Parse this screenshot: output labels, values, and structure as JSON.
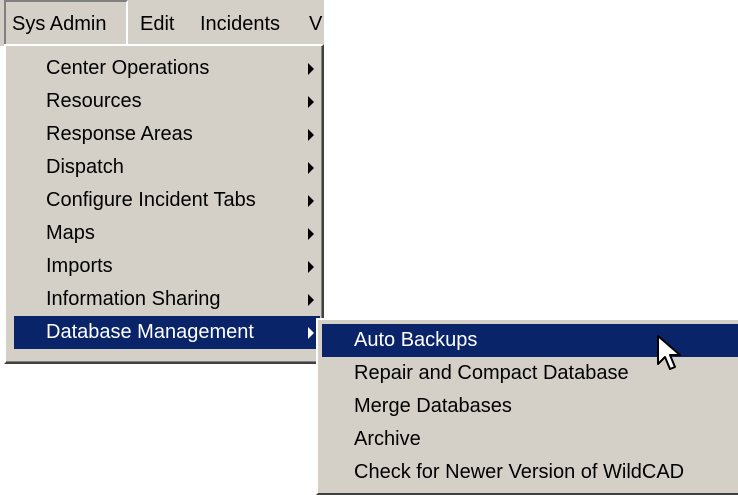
{
  "menubar": {
    "items": [
      {
        "label": "Sys Admin"
      },
      {
        "label": "Edit"
      },
      {
        "label": "Incidents"
      },
      {
        "label": "V"
      }
    ]
  },
  "sys_admin_menu": {
    "items": [
      {
        "label": "Center Operations",
        "has_submenu": true
      },
      {
        "label": "Resources",
        "has_submenu": true
      },
      {
        "label": "Response Areas",
        "has_submenu": true
      },
      {
        "label": "Dispatch",
        "has_submenu": true
      },
      {
        "label": "Configure Incident Tabs",
        "has_submenu": true
      },
      {
        "label": "Maps",
        "has_submenu": true
      },
      {
        "label": "Imports",
        "has_submenu": true
      },
      {
        "label": "Information Sharing",
        "has_submenu": true
      },
      {
        "label": "Database Management",
        "has_submenu": true,
        "selected": true
      }
    ]
  },
  "database_management_submenu": {
    "items": [
      {
        "label": "Auto Backups",
        "selected": true
      },
      {
        "label": "Repair and Compact Database"
      },
      {
        "label": "Merge Databases"
      },
      {
        "label": "Archive"
      },
      {
        "label": "Check for Newer Version of WildCAD"
      }
    ]
  },
  "colors": {
    "menu_background": "#d4d0c8",
    "selection_background": "#0a246a",
    "selection_text": "#ffffff"
  },
  "icons": {
    "submenu_arrow": "right-triangle",
    "cursor": "mouse-pointer-arrow"
  }
}
